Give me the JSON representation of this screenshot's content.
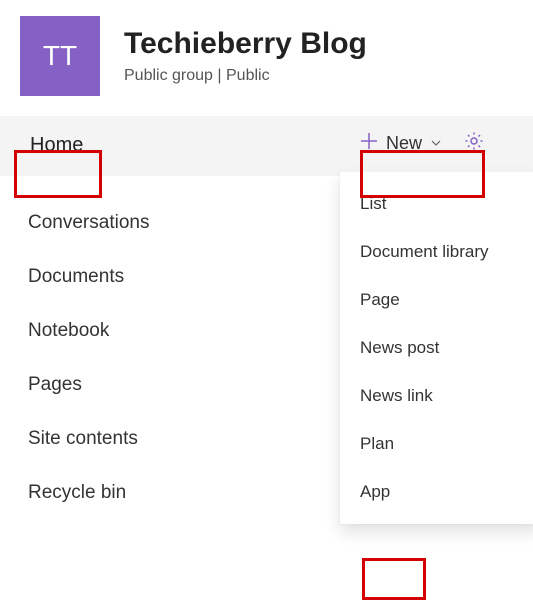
{
  "site": {
    "logoText": "TT",
    "title": "Techieberry Blog",
    "subtitle": "Public group | Public"
  },
  "sidebar": {
    "home": "Home",
    "items": [
      {
        "label": "Conversations"
      },
      {
        "label": "Documents"
      },
      {
        "label": "Notebook"
      },
      {
        "label": "Pages"
      },
      {
        "label": "Site contents"
      },
      {
        "label": "Recycle bin"
      }
    ]
  },
  "commandBar": {
    "newLabel": "New"
  },
  "newMenu": {
    "items": [
      {
        "label": "List"
      },
      {
        "label": "Document library"
      },
      {
        "label": "Page"
      },
      {
        "label": "News post"
      },
      {
        "label": "News link"
      },
      {
        "label": "Plan"
      },
      {
        "label": "App"
      }
    ]
  }
}
